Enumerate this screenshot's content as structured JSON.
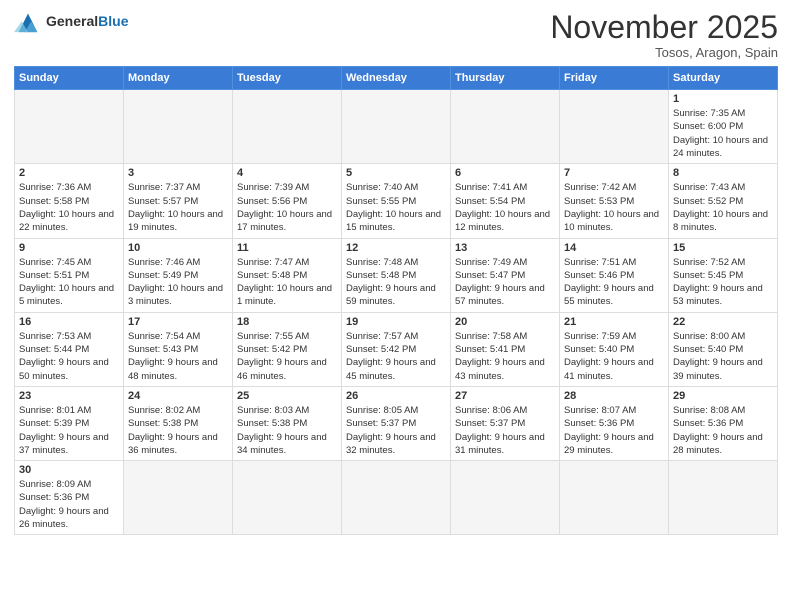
{
  "logo": {
    "line1": "General",
    "line2": "Blue"
  },
  "header": {
    "title": "November 2025",
    "location": "Tosos, Aragon, Spain"
  },
  "weekdays": [
    "Sunday",
    "Monday",
    "Tuesday",
    "Wednesday",
    "Thursday",
    "Friday",
    "Saturday"
  ],
  "weeks": [
    [
      {
        "day": "",
        "info": ""
      },
      {
        "day": "",
        "info": ""
      },
      {
        "day": "",
        "info": ""
      },
      {
        "day": "",
        "info": ""
      },
      {
        "day": "",
        "info": ""
      },
      {
        "day": "",
        "info": ""
      },
      {
        "day": "1",
        "info": "Sunrise: 7:35 AM\nSunset: 6:00 PM\nDaylight: 10 hours and 24 minutes."
      }
    ],
    [
      {
        "day": "2",
        "info": "Sunrise: 7:36 AM\nSunset: 5:58 PM\nDaylight: 10 hours and 22 minutes."
      },
      {
        "day": "3",
        "info": "Sunrise: 7:37 AM\nSunset: 5:57 PM\nDaylight: 10 hours and 19 minutes."
      },
      {
        "day": "4",
        "info": "Sunrise: 7:39 AM\nSunset: 5:56 PM\nDaylight: 10 hours and 17 minutes."
      },
      {
        "day": "5",
        "info": "Sunrise: 7:40 AM\nSunset: 5:55 PM\nDaylight: 10 hours and 15 minutes."
      },
      {
        "day": "6",
        "info": "Sunrise: 7:41 AM\nSunset: 5:54 PM\nDaylight: 10 hours and 12 minutes."
      },
      {
        "day": "7",
        "info": "Sunrise: 7:42 AM\nSunset: 5:53 PM\nDaylight: 10 hours and 10 minutes."
      },
      {
        "day": "8",
        "info": "Sunrise: 7:43 AM\nSunset: 5:52 PM\nDaylight: 10 hours and 8 minutes."
      }
    ],
    [
      {
        "day": "9",
        "info": "Sunrise: 7:45 AM\nSunset: 5:51 PM\nDaylight: 10 hours and 5 minutes."
      },
      {
        "day": "10",
        "info": "Sunrise: 7:46 AM\nSunset: 5:49 PM\nDaylight: 10 hours and 3 minutes."
      },
      {
        "day": "11",
        "info": "Sunrise: 7:47 AM\nSunset: 5:48 PM\nDaylight: 10 hours and 1 minute."
      },
      {
        "day": "12",
        "info": "Sunrise: 7:48 AM\nSunset: 5:48 PM\nDaylight: 9 hours and 59 minutes."
      },
      {
        "day": "13",
        "info": "Sunrise: 7:49 AM\nSunset: 5:47 PM\nDaylight: 9 hours and 57 minutes."
      },
      {
        "day": "14",
        "info": "Sunrise: 7:51 AM\nSunset: 5:46 PM\nDaylight: 9 hours and 55 minutes."
      },
      {
        "day": "15",
        "info": "Sunrise: 7:52 AM\nSunset: 5:45 PM\nDaylight: 9 hours and 53 minutes."
      }
    ],
    [
      {
        "day": "16",
        "info": "Sunrise: 7:53 AM\nSunset: 5:44 PM\nDaylight: 9 hours and 50 minutes."
      },
      {
        "day": "17",
        "info": "Sunrise: 7:54 AM\nSunset: 5:43 PM\nDaylight: 9 hours and 48 minutes."
      },
      {
        "day": "18",
        "info": "Sunrise: 7:55 AM\nSunset: 5:42 PM\nDaylight: 9 hours and 46 minutes."
      },
      {
        "day": "19",
        "info": "Sunrise: 7:57 AM\nSunset: 5:42 PM\nDaylight: 9 hours and 45 minutes."
      },
      {
        "day": "20",
        "info": "Sunrise: 7:58 AM\nSunset: 5:41 PM\nDaylight: 9 hours and 43 minutes."
      },
      {
        "day": "21",
        "info": "Sunrise: 7:59 AM\nSunset: 5:40 PM\nDaylight: 9 hours and 41 minutes."
      },
      {
        "day": "22",
        "info": "Sunrise: 8:00 AM\nSunset: 5:40 PM\nDaylight: 9 hours and 39 minutes."
      }
    ],
    [
      {
        "day": "23",
        "info": "Sunrise: 8:01 AM\nSunset: 5:39 PM\nDaylight: 9 hours and 37 minutes."
      },
      {
        "day": "24",
        "info": "Sunrise: 8:02 AM\nSunset: 5:38 PM\nDaylight: 9 hours and 36 minutes."
      },
      {
        "day": "25",
        "info": "Sunrise: 8:03 AM\nSunset: 5:38 PM\nDaylight: 9 hours and 34 minutes."
      },
      {
        "day": "26",
        "info": "Sunrise: 8:05 AM\nSunset: 5:37 PM\nDaylight: 9 hours and 32 minutes."
      },
      {
        "day": "27",
        "info": "Sunrise: 8:06 AM\nSunset: 5:37 PM\nDaylight: 9 hours and 31 minutes."
      },
      {
        "day": "28",
        "info": "Sunrise: 8:07 AM\nSunset: 5:36 PM\nDaylight: 9 hours and 29 minutes."
      },
      {
        "day": "29",
        "info": "Sunrise: 8:08 AM\nSunset: 5:36 PM\nDaylight: 9 hours and 28 minutes."
      }
    ],
    [
      {
        "day": "30",
        "info": "Sunrise: 8:09 AM\nSunset: 5:36 PM\nDaylight: 9 hours and 26 minutes."
      },
      {
        "day": "",
        "info": ""
      },
      {
        "day": "",
        "info": ""
      },
      {
        "day": "",
        "info": ""
      },
      {
        "day": "",
        "info": ""
      },
      {
        "day": "",
        "info": ""
      },
      {
        "day": "",
        "info": ""
      }
    ]
  ]
}
